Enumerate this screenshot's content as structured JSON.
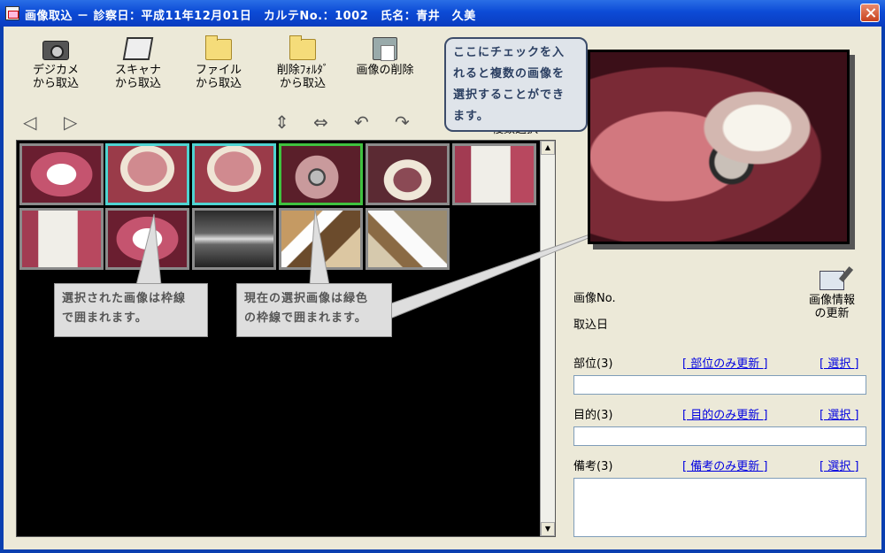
{
  "window": {
    "title": "画像取込 － 診察日：平成11年12月01日　カルテNo.：1002　氏名：青井　久美"
  },
  "toolbar": {
    "camera": {
      "line1": "デジカメ",
      "line2": "から取込",
      "icon": "camera-icon"
    },
    "scanner": {
      "line1": "スキャナ",
      "line2": "から取込",
      "icon": "scanner-icon"
    },
    "file": {
      "line1": "ファイル",
      "line2": "から取込",
      "icon": "folder-icon"
    },
    "delete_folder": {
      "line1": "削除ﾌｫﾙﾀﾞ",
      "line2": "から取込",
      "icon": "recycle-folder-icon"
    },
    "delete_image": {
      "line1": "画像の削除",
      "icon": "delete-image-icon"
    }
  },
  "nav": {
    "prev": "◁",
    "next": "▷",
    "flip_vertical": "⇕",
    "flip_horizontal": "⇔",
    "rotate_left": "↶",
    "rotate_right": "↷"
  },
  "multi_select": {
    "label": "複数選択",
    "checked": true,
    "mark": "✓"
  },
  "thumbnails": [
    {
      "kind": "front-teeth",
      "state": "normal"
    },
    {
      "kind": "upper-arch",
      "state": "selected"
    },
    {
      "kind": "upper-arch",
      "state": "selected"
    },
    {
      "kind": "mirror-view",
      "state": "current"
    },
    {
      "kind": "lower-arch",
      "state": "normal"
    },
    {
      "kind": "side-teeth",
      "state": "normal"
    },
    {
      "kind": "side-teeth",
      "state": "normal"
    },
    {
      "kind": "retractor-view",
      "state": "normal"
    },
    {
      "kind": "x-ray",
      "state": "normal"
    },
    {
      "kind": "clinic-room",
      "state": "normal"
    },
    {
      "kind": "clinic-room",
      "state": "normal"
    }
  ],
  "callouts": {
    "selected": {
      "line1": "選択された画像は枠線",
      "line2": "で囲まれます。"
    },
    "current": {
      "line1": "現在の選択画像は緑色",
      "line2": "の枠線で囲まれます。"
    },
    "multi": {
      "line1": "ここにチェックを入",
      "line2": "れると複数の画像を",
      "line3": "選択することができ",
      "line4": "ます。"
    }
  },
  "info": {
    "image_no_label": "画像No.",
    "import_date_label": "取込日",
    "update_button": {
      "line1": "画像情報",
      "line2": "の更新",
      "icon": "edit-image-icon"
    },
    "part": {
      "label": "部位(3)",
      "update_link": "[ 部位のみ更新 ]",
      "select_link": "[ 選択 ]",
      "value": ""
    },
    "purpose": {
      "label": "目的(3)",
      "update_link": "[ 目的のみ更新 ]",
      "select_link": "[ 選択 ]",
      "value": ""
    },
    "notes": {
      "label": "備考(3)",
      "update_link": "[ 備考のみ更新 ]",
      "select_link": "[ 選択 ]",
      "value": ""
    }
  },
  "colors": {
    "selected_border": "#4fd3d1",
    "current_border": "#3fc23f",
    "normal_border": "#8b8b8b"
  }
}
